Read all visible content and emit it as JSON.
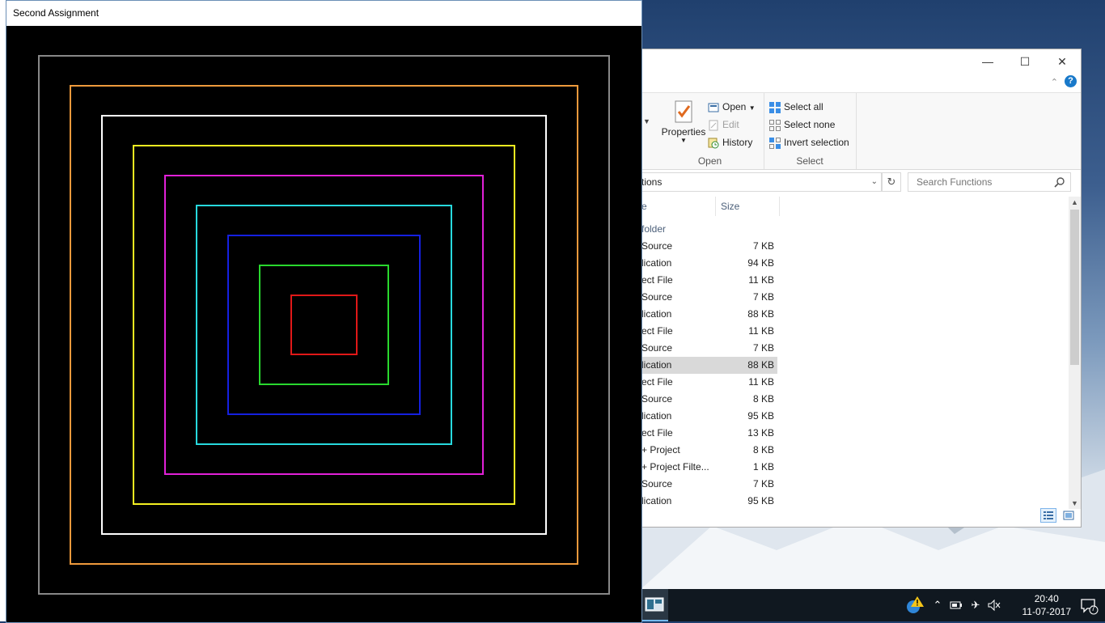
{
  "gl_window": {
    "title": "Second Assignment",
    "squares": [
      {
        "color": "#888888"
      },
      {
        "color": "#ef9a3c"
      },
      {
        "color": "#ffffff"
      },
      {
        "color": "#f4f021"
      },
      {
        "color": "#e221d8"
      },
      {
        "color": "#27d9de"
      },
      {
        "color": "#1520e0"
      },
      {
        "color": "#29d82e"
      },
      {
        "color": "#e01818"
      }
    ]
  },
  "explorer": {
    "ribbon": {
      "open_group": {
        "properties_label": "Properties",
        "open_label": "Open",
        "edit_label": "Edit",
        "history_label": "History",
        "group_label": "Open"
      },
      "select_group": {
        "select_all_label": "Select all",
        "select_none_label": "Select none",
        "invert_label": "Invert selection",
        "group_label": "Select"
      }
    },
    "address_text": "tions",
    "search_placeholder": "Search Functions",
    "columns": {
      "name": "e",
      "size": "Size"
    },
    "group_header": "folder",
    "rows": [
      {
        "name": "Source",
        "size": "7 KB"
      },
      {
        "name": "lication",
        "size": "94 KB"
      },
      {
        "name": "ect File",
        "size": "11 KB"
      },
      {
        "name": "Source",
        "size": "7 KB"
      },
      {
        "name": "lication",
        "size": "88 KB"
      },
      {
        "name": "ect File",
        "size": "11 KB"
      },
      {
        "name": "Source",
        "size": "7 KB"
      },
      {
        "name": "lication",
        "size": "88 KB",
        "selected": true
      },
      {
        "name": "ect File",
        "size": "11 KB"
      },
      {
        "name": "Source",
        "size": "8 KB"
      },
      {
        "name": "lication",
        "size": "95 KB"
      },
      {
        "name": "ect File",
        "size": "13 KB"
      },
      {
        "name": "+ Project",
        "size": "8 KB"
      },
      {
        "name": "+ Project Filte...",
        "size": "1 KB"
      },
      {
        "name": "Source",
        "size": "7 KB"
      },
      {
        "name": "lication",
        "size": "95 KB"
      }
    ]
  },
  "taskbar": {
    "time": "20:40",
    "date": "11-07-2017",
    "notification_count": "7"
  },
  "colors": {
    "accent": "#1979ca",
    "selected_row": "#d9d9d9"
  }
}
